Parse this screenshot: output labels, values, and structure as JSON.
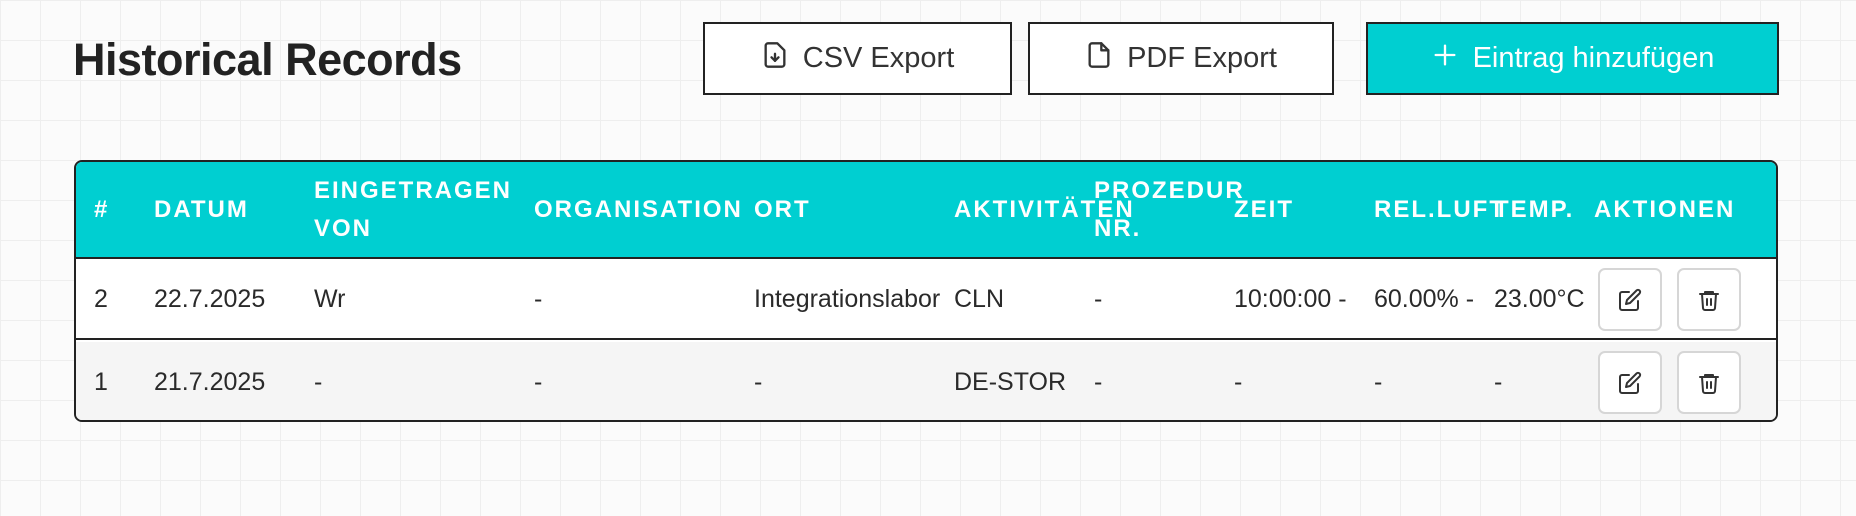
{
  "header": {
    "title": "Historical Records",
    "csv_label": "CSV Export",
    "pdf_label": "PDF Export",
    "add_label": "Eintrag hinzufügen"
  },
  "icons": {
    "csv": "file-download-icon",
    "pdf": "file-icon",
    "add": "plus-icon",
    "edit": "edit-icon",
    "delete": "trash-icon"
  },
  "colors": {
    "accent": "#00cfd1",
    "border": "#222222"
  },
  "table": {
    "columns": [
      "#",
      "DATUM",
      "EINGETRAGEN VON",
      "ORGANISATION",
      "ORT",
      "AKTIVITÄTEN",
      "PROZEDUR NR.",
      "ZEIT",
      "REL.LUFTF.",
      "TEMP.",
      "AKTIONEN"
    ],
    "rows": [
      [
        "2",
        "22.7.2025",
        "Wr",
        "-",
        "Integrationslabor",
        "CLN",
        "-",
        "10:00:00 -",
        "60.00% -",
        "23.00°C"
      ],
      [
        "1",
        "21.7.2025",
        "-",
        "-",
        "-",
        "DE-STOR",
        "-",
        "-",
        "-",
        "-"
      ]
    ]
  }
}
